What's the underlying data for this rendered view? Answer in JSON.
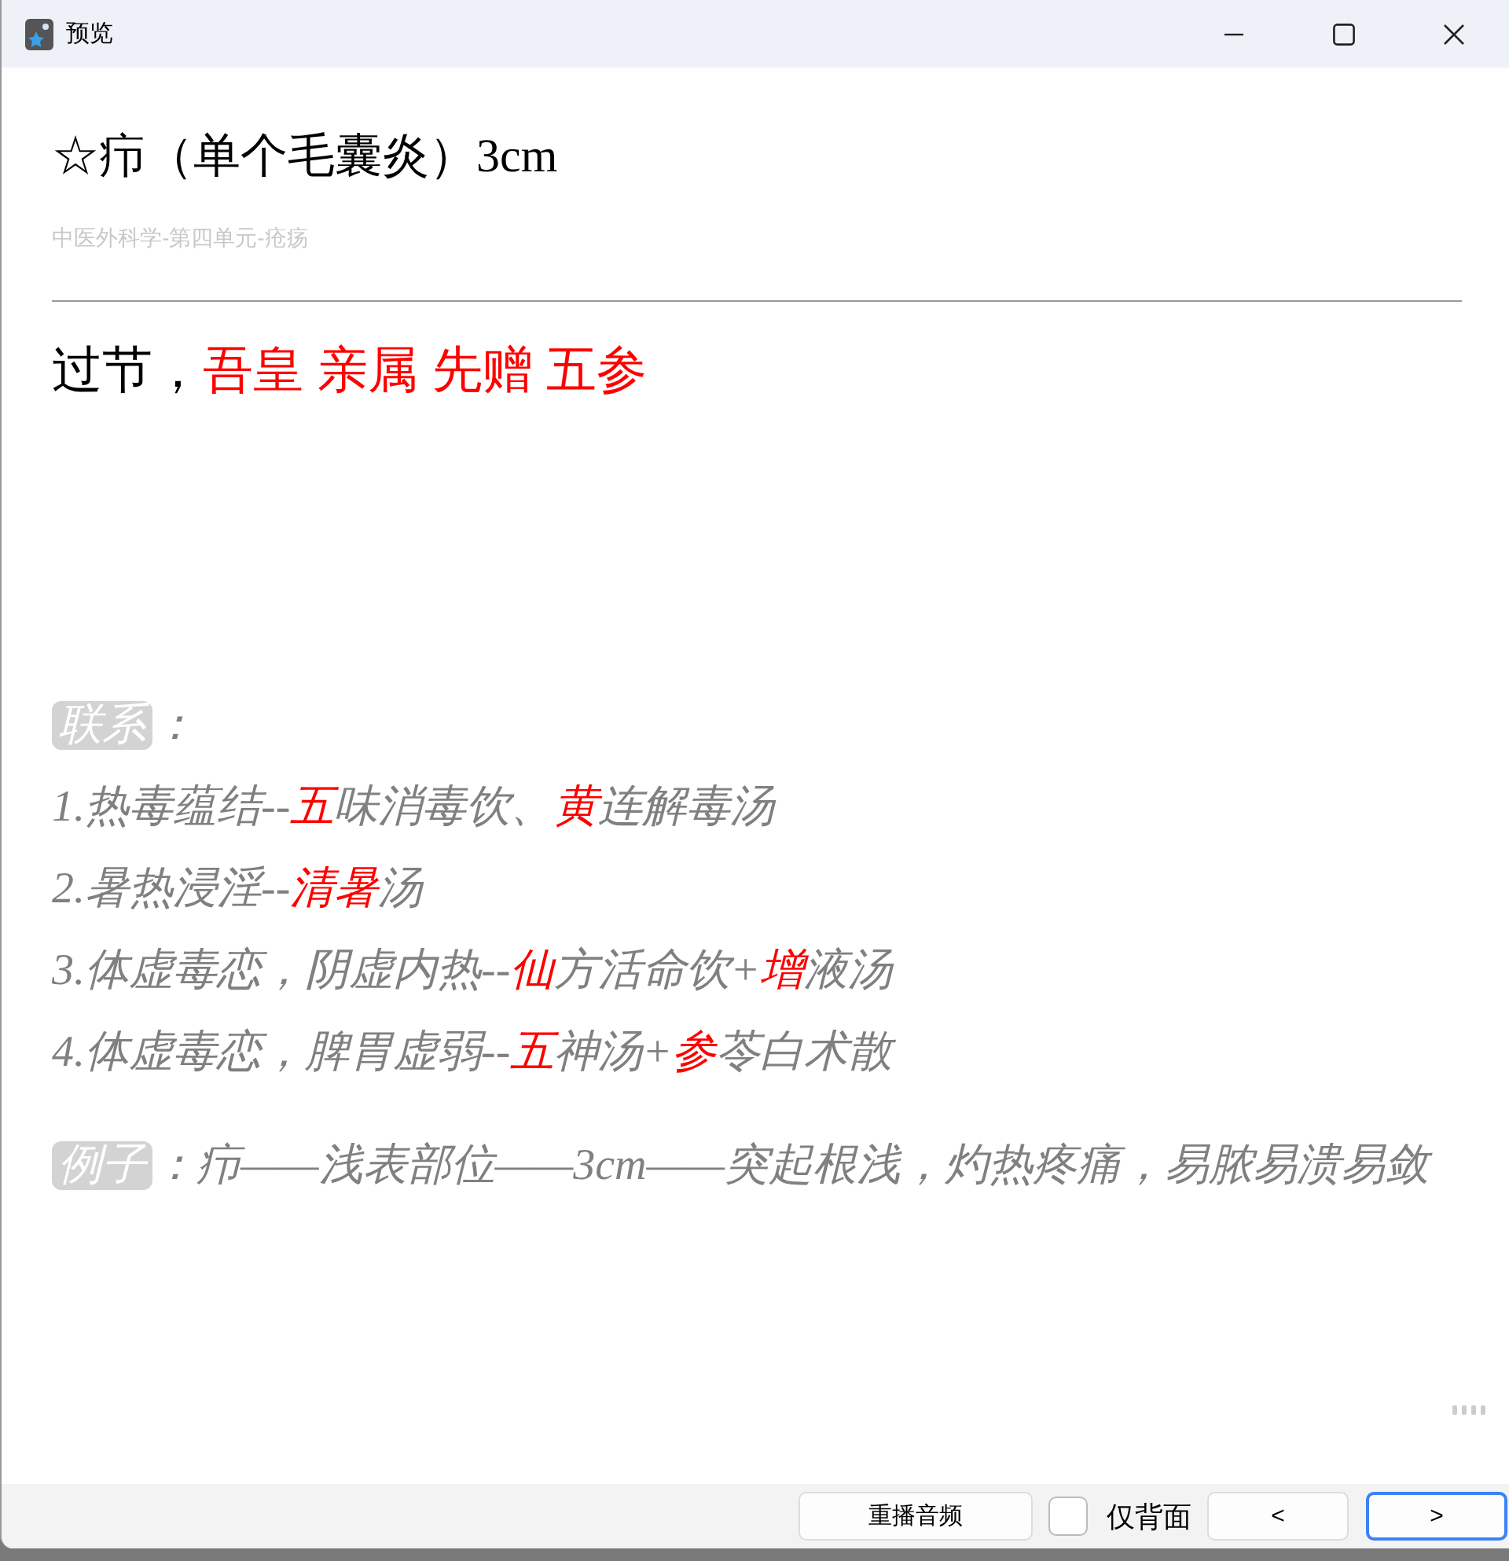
{
  "window": {
    "title": "预览"
  },
  "card": {
    "heading": "☆疖（单个毛囊炎）3cm",
    "breadcrumb": "中医外科学-第四单元-疮疡",
    "mnemonic": [
      {
        "text": "过节，",
        "highlight": false
      },
      {
        "text": "吾皇 亲属 先赠 五参",
        "highlight": true
      }
    ],
    "links": {
      "tag": "联系",
      "colon": "：",
      "lines": [
        [
          {
            "text": "1.热毒蕴结--",
            "highlight": false
          },
          {
            "text": "五",
            "highlight": true
          },
          {
            "text": "味消毒饮、",
            "highlight": false
          },
          {
            "text": "黄",
            "highlight": true
          },
          {
            "text": "连解毒汤",
            "highlight": false
          }
        ],
        [
          {
            "text": "2.暑热浸淫--",
            "highlight": false
          },
          {
            "text": "清暑",
            "highlight": true
          },
          {
            "text": "汤",
            "highlight": false
          }
        ],
        [
          {
            "text": "3.体虚毒恋，阴虚内热--",
            "highlight": false
          },
          {
            "text": "仙",
            "highlight": true
          },
          {
            "text": "方活命饮+",
            "highlight": false
          },
          {
            "text": "增",
            "highlight": true
          },
          {
            "text": "液汤",
            "highlight": false
          }
        ],
        [
          {
            "text": "4.体虚毒恋，脾胃虚弱--",
            "highlight": false
          },
          {
            "text": "五",
            "highlight": true
          },
          {
            "text": "神汤+",
            "highlight": false
          },
          {
            "text": "参",
            "highlight": true
          },
          {
            "text": "苓白术散",
            "highlight": false
          }
        ]
      ]
    },
    "example": {
      "tag": "例子",
      "text": "：疖——浅表部位——3cm——突起根浅，灼热疼痛，易脓易溃易敛"
    }
  },
  "toolbar": {
    "replay_button": {
      "label": "重播音频",
      "focused": false
    },
    "back_only": {
      "label": "仅背面",
      "checked": false
    },
    "nav_buttons": [
      {
        "label": "<",
        "focused": false
      },
      {
        "label": ">",
        "focused": true
      }
    ]
  }
}
